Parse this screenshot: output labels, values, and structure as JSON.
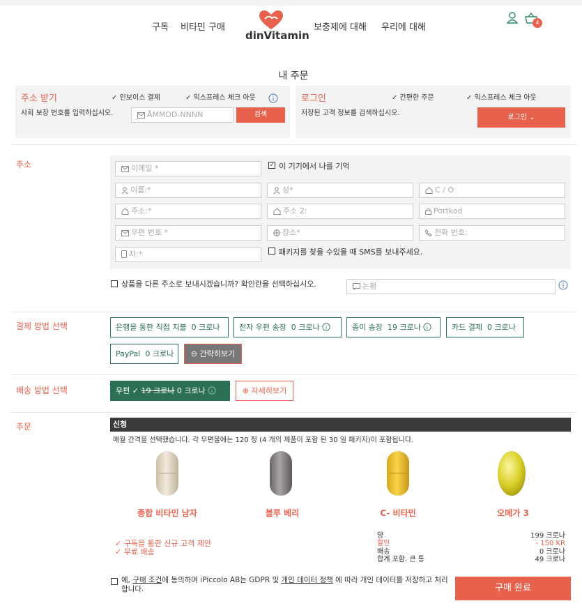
{
  "nav": {
    "subscribe": "구독",
    "buy_vitamins": "비타민 구매",
    "logo_text": "dinVitamin",
    "about_supplements": "보충제에 대해",
    "about_us": "우리에 대해",
    "cart_count": "4"
  },
  "page_title": "내 주문",
  "address_receive": {
    "title": "주소 받기",
    "check1": "인보이스 결제",
    "check2": "익스프레스 체크 아웃",
    "instruction": "사회 보장 번호를 입력하십시오.",
    "ssn_placeholder": "ÅMMDD-NNNN",
    "search_button": "검색"
  },
  "login_panel": {
    "title": "로그인",
    "check1": "간편한 주문",
    "check2": "익스프레스 체크 아웃",
    "instruction": "저장된 고객 정보를 검색하십시오.",
    "login_button": "로그인"
  },
  "address": {
    "section_label": "주소",
    "email": "이메일 *",
    "remember": "이 기기에서 나를 기억",
    "first_name": "이름:*",
    "last_name": "성*",
    "co": "C / O",
    "address1": "주소:*",
    "address2": "주소 2:",
    "postcode_short": "Portkod",
    "zip": "우편 번호 *",
    "city": "장소*",
    "phone": "전화 번호:",
    "car": "차:*",
    "sms": "패키지를 찾을 수있을 때 SMS를 보내주세요.",
    "other_address": "상품을 다른 주소로 보내시겠습니까? 확인란을 선택하십시오.",
    "comment": "논평"
  },
  "payment": {
    "section_label": "결제 방법 선택",
    "options": [
      {
        "label": "은행을 통한 직접 지불",
        "price": "0 크로나"
      },
      {
        "label": "전자 우편 송장",
        "price": "0 크로나"
      },
      {
        "label": "종이 송장",
        "price": "19 크로나"
      },
      {
        "label": "카드 결제",
        "price": "0 크로나"
      },
      {
        "label": "PayPal",
        "price": "0 크로나"
      }
    ],
    "collapse": "간략히보기"
  },
  "shipping": {
    "section_label": "배송 방법 선택",
    "selected_label": "우편",
    "old_price": "19 크로나",
    "price": "0 크로나",
    "details": "자세히보기"
  },
  "order": {
    "section_label": "주문",
    "header": "신청",
    "description": "매월 간격을 선택했습니다. 각 우편물에는 120 정 (4 개의 제품이 포함 된 30 일 패키지)이 포함됩니다.",
    "products": [
      {
        "name": "종합 비타민 남자"
      },
      {
        "name": "블루 베리"
      },
      {
        "name": "C- 비타민"
      },
      {
        "name": "오메가 3"
      }
    ],
    "perks": [
      "구독을 통한 신규 고객 제안",
      "무료 배송"
    ],
    "summary": [
      {
        "label": "양",
        "value": "199 크로나"
      },
      {
        "label": "할인",
        "value": "- 150 KR"
      },
      {
        "label": "배송",
        "value": "0 크로나"
      },
      {
        "label": "합계 포함. 큰 통",
        "value": "49 크로나"
      }
    ],
    "terms_prefix": "예, ",
    "terms_link": "구매 조건",
    "terms_mid": "에 동의하며 iPiccolo AB는 GDPR 및 ",
    "privacy_link": "개인 데이터 정책",
    "terms_suffix": " 에 따라 개인 데이터를 저장하고 처리합니다.",
    "complete_button": "구매 완료"
  },
  "colors": {
    "accent": "#e8614d",
    "green": "#2b6f55",
    "panel": "#f3f3f3"
  }
}
